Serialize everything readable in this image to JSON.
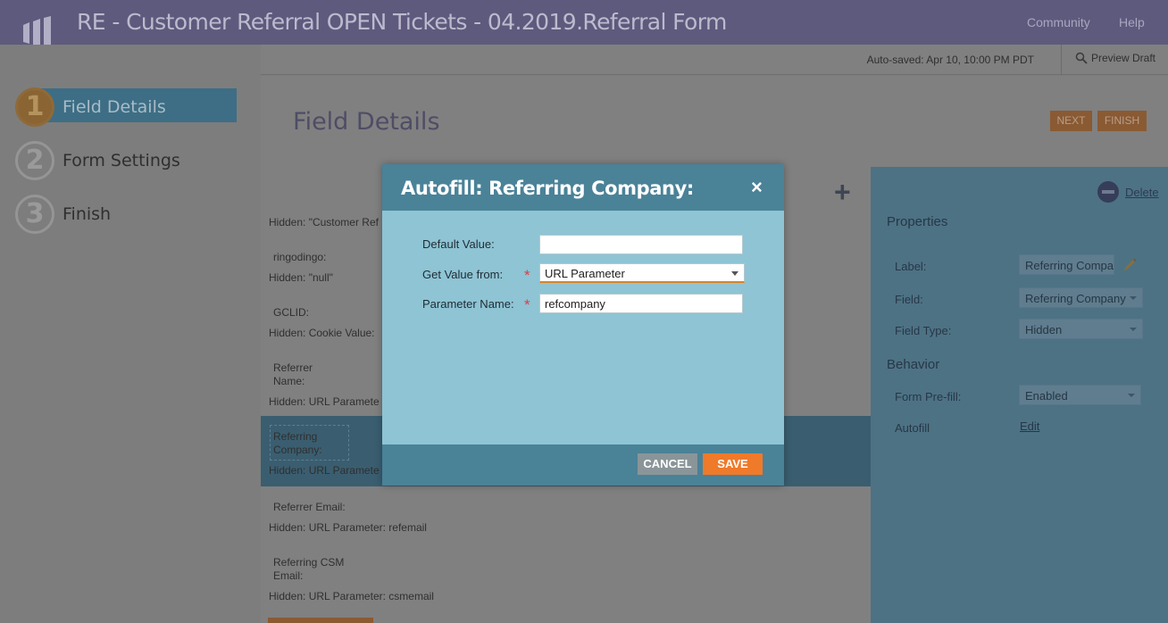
{
  "app": {
    "title": "RE - Customer Referral OPEN Tickets - 04.2019.Referral Form",
    "community": "Community",
    "help": "Help"
  },
  "subbar": {
    "autosaved": "Auto-saved: Apr 10, 10:00 PM PDT",
    "preview": "Preview Draft"
  },
  "steps": [
    {
      "num": "1",
      "label": "Field Details"
    },
    {
      "num": "2",
      "label": "Form Settings"
    },
    {
      "num": "3",
      "label": "Finish"
    }
  ],
  "main": {
    "title": "Field Details",
    "next": "NEXT",
    "finish": "FINISH"
  },
  "fields": {
    "f1": "Hidden: \"Customer Ref",
    "f2_name": "ringodingo:",
    "f2_val": "Hidden: \"null\"",
    "f3_name": "GCLID:",
    "f3_val": "Hidden: Cookie Value:",
    "f4_name_1": "Referrer",
    "f4_name_2": "Name:",
    "f4_val": "Hidden: URL Paramete",
    "f5_name_1": "Referring",
    "f5_name_2": "Company:",
    "f5_val": "Hidden: URL Paramete",
    "f6_name": "Referrer Email:",
    "f6_val": "Hidden: URL Parameter: refemail",
    "f7_name_1": "Referring CSM",
    "f7_name_2": "Email:",
    "f7_val": "Hidden: URL Parameter: csmemail"
  },
  "properties": {
    "delete": "Delete",
    "properties_title": "Properties",
    "label_label": "Label:",
    "label_value": "Referring Compa",
    "field_label": "Field:",
    "field_value": "Referring Company",
    "field_type_label": "Field Type:",
    "field_type_value": "Hidden",
    "behavior_title": "Behavior",
    "prefill_label": "Form Pre-fill:",
    "prefill_value": "Enabled",
    "autofill_label": "Autofill",
    "autofill_edit": "Edit"
  },
  "modal": {
    "title": "Autofill: Referring Company:",
    "close": "×",
    "default_value_label": "Default Value:",
    "default_value": "",
    "get_value_label": "Get Value from:",
    "get_value": "URL Parameter",
    "param_name_label": "Parameter Name:",
    "param_name": "refcompany",
    "required_star": "*",
    "cancel": "CANCEL",
    "save": "SAVE"
  },
  "colors": {
    "accent_orange": "#ef7a2a",
    "modal_header": "#4a8298",
    "modal_body": "#8ec4d4",
    "topbar": "#5d5a7d"
  }
}
